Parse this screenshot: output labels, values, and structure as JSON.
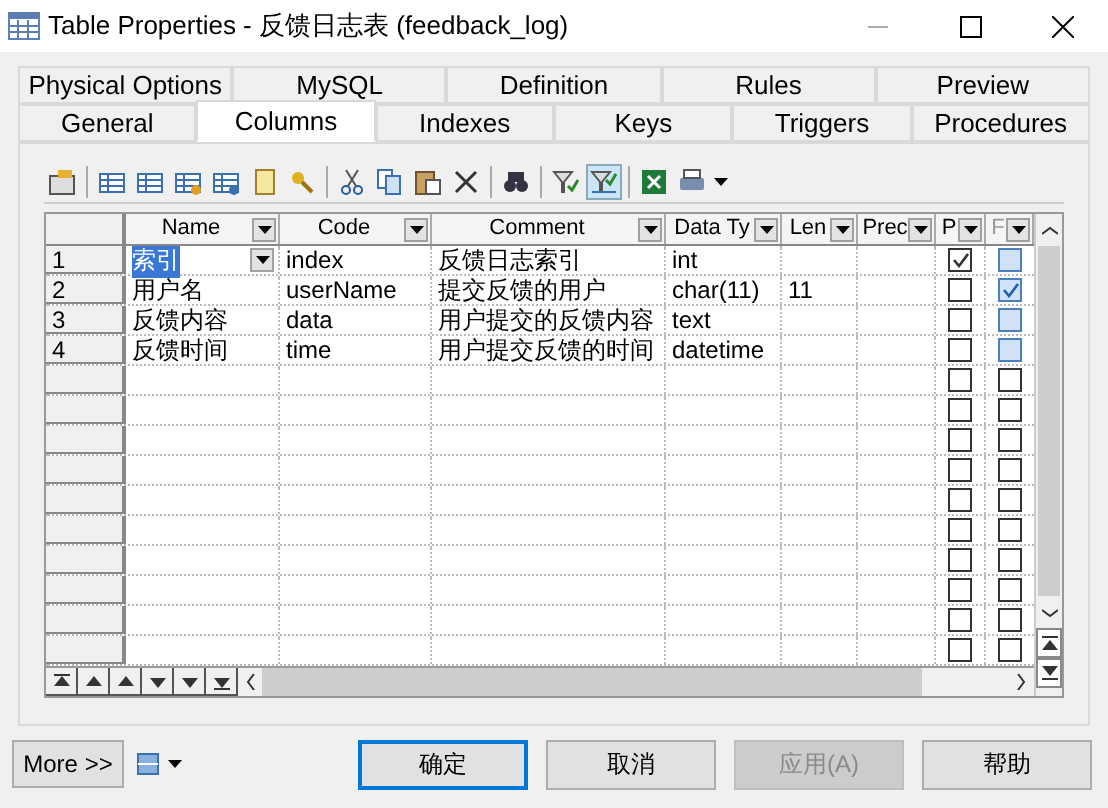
{
  "window": {
    "title": "Table Properties - 反馈日志表 (feedback_log)"
  },
  "tab_rows": [
    [
      {
        "label": "Physical Options",
        "selected": false
      },
      {
        "label": "MySQL",
        "selected": false
      },
      {
        "label": "Definition",
        "selected": false
      },
      {
        "label": "Rules",
        "selected": false
      },
      {
        "label": "Preview",
        "selected": false
      }
    ],
    [
      {
        "label": "General",
        "selected": false
      },
      {
        "label": "Columns",
        "selected": true
      },
      {
        "label": "Indexes",
        "selected": false
      },
      {
        "label": "Keys",
        "selected": false
      },
      {
        "label": "Triggers",
        "selected": false
      },
      {
        "label": "Procedures",
        "selected": false
      }
    ]
  ],
  "table": {
    "columns": [
      "Name",
      "Code",
      "Comment",
      "Data Ty",
      "Len",
      "Prec",
      "P",
      "F"
    ],
    "rows": [
      {
        "number": "1",
        "cells": [
          "索引",
          "index",
          "反馈日志索引",
          "int"
        ],
        "selected": true,
        "primary": true,
        "foreign": false
      },
      {
        "number": "2",
        "cells": [
          "用户名",
          "userName",
          "提交反馈的用户",
          "char(11)",
          "11"
        ],
        "selected": false,
        "primary": false,
        "foreign": true
      },
      {
        "number": "3",
        "cells": [
          "反馈内容",
          "data",
          "用户提交的反馈内容",
          "text"
        ],
        "selected": false,
        "primary": false,
        "foreign": false
      },
      {
        "number": "4",
        "cells": [
          "反馈时间",
          "time",
          "用户提交反馈的时间",
          "datetime"
        ],
        "selected": false,
        "primary": false,
        "foreign": false
      },
      {
        "primary": false,
        "foreign": false
      },
      {
        "primary": false,
        "foreign": false
      },
      {
        "primary": false,
        "foreign": false
      },
      {
        "primary": false,
        "foreign": false
      },
      {
        "primary": false,
        "foreign": false
      },
      {
        "primary": false,
        "foreign": false
      },
      {
        "primary": false,
        "foreign": false
      },
      {
        "primary": false,
        "foreign": false
      },
      {
        "primary": false,
        "foreign": false
      },
      {
        "primary": false,
        "foreign": false
      }
    ]
  },
  "more_button": "More >>",
  "buttons": [
    {
      "label": "确定",
      "default": true,
      "disabled": false
    },
    {
      "label": "取消",
      "default": false,
      "disabled": false
    },
    {
      "label": "应用(A)",
      "default": false,
      "disabled": true
    },
    {
      "label": "帮助",
      "default": false,
      "disabled": false
    }
  ]
}
